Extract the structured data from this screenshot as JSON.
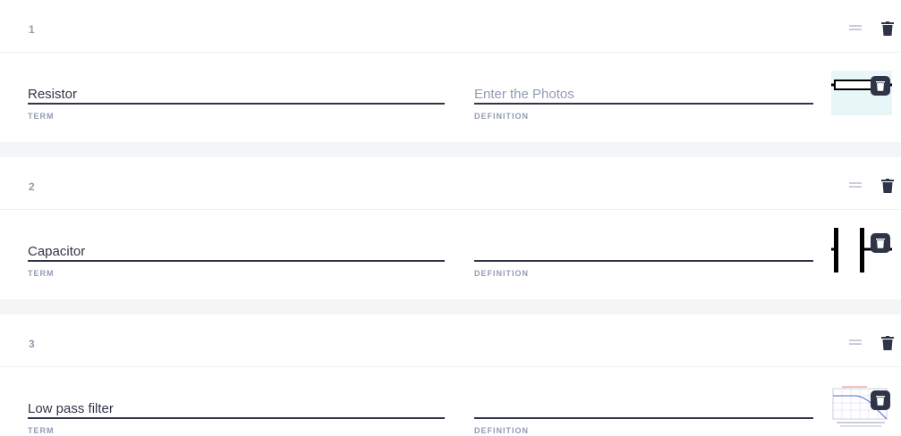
{
  "cards": [
    {
      "number": "1",
      "term": {
        "value": "Resistor",
        "label": "TERM"
      },
      "definition": {
        "value": "",
        "placeholder": "Enter the Photos",
        "label": "DEFINITION"
      },
      "image": {
        "icon": "resistor-symbol-icon",
        "kind": "resistor"
      }
    },
    {
      "number": "2",
      "term": {
        "value": "Capacitor",
        "label": "TERM"
      },
      "definition": {
        "value": "",
        "placeholder": "",
        "label": "DEFINITION"
      },
      "image": {
        "icon": "capacitor-symbol-icon",
        "kind": "capacitor"
      }
    },
    {
      "number": "3",
      "term": {
        "value": "Low pass filter",
        "label": "TERM"
      },
      "definition": {
        "value": "",
        "placeholder": "",
        "label": "DEFINITION"
      },
      "image": {
        "icon": "bode-plot-icon",
        "kind": "plot"
      }
    }
  ],
  "icons": {
    "drag": "drag-handle-icon",
    "delete": "trash-icon"
  },
  "colors": {
    "text": "#303545",
    "muted": "#939bb4",
    "background": "#f4f5f6",
    "card": "#ffffff"
  }
}
